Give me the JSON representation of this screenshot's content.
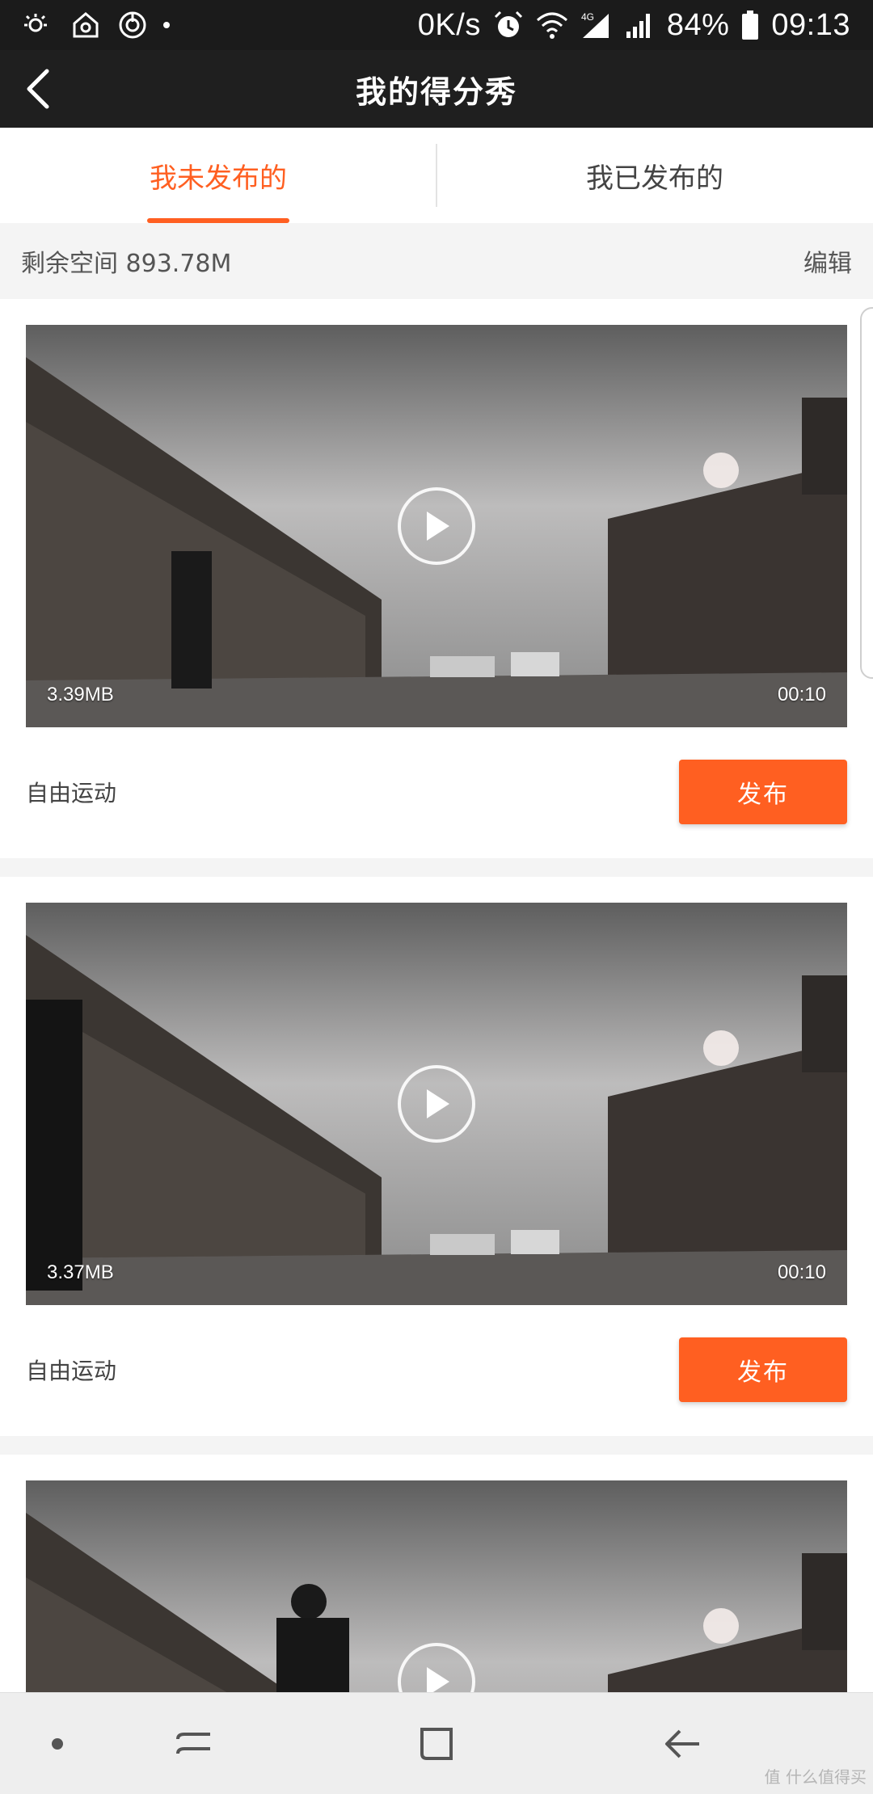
{
  "status_bar": {
    "network_speed": "0K/s",
    "network_type": "4G",
    "battery": "84%",
    "time": "09:13"
  },
  "app_bar": {
    "title": "我的得分秀",
    "back_icon": "back-arrow-icon"
  },
  "tabs": [
    {
      "label": "我未发布的",
      "active": true
    },
    {
      "label": "我已发布的",
      "active": false
    }
  ],
  "storage": {
    "text": "剩余空间 893.78M",
    "edit_label": "编辑"
  },
  "videos": [
    {
      "size": "3.39MB",
      "duration": "00:10",
      "label": "自由运动",
      "button": "发布"
    },
    {
      "size": "3.37MB",
      "duration": "00:10",
      "label": "自由运动",
      "button": "发布"
    },
    {
      "size": "",
      "duration": "",
      "label": "",
      "button": ""
    }
  ],
  "nav_bar": {
    "icons": [
      "dot-icon",
      "recent-apps-icon",
      "home-icon",
      "back-icon"
    ]
  },
  "watermark": "值 什么值得买",
  "colors": {
    "accent": "#ff5f21",
    "header": "#1f1f1f"
  }
}
